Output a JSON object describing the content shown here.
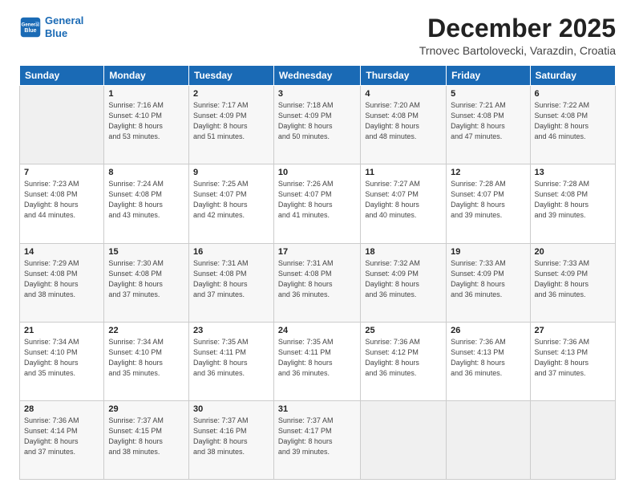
{
  "header": {
    "logo_line1": "General",
    "logo_line2": "Blue",
    "month": "December 2025",
    "location": "Trnovec Bartolovecki, Varazdin, Croatia"
  },
  "weekdays": [
    "Sunday",
    "Monday",
    "Tuesday",
    "Wednesday",
    "Thursday",
    "Friday",
    "Saturday"
  ],
  "weeks": [
    [
      {
        "day": "",
        "text": ""
      },
      {
        "day": "1",
        "text": "Sunrise: 7:16 AM\nSunset: 4:10 PM\nDaylight: 8 hours\nand 53 minutes."
      },
      {
        "day": "2",
        "text": "Sunrise: 7:17 AM\nSunset: 4:09 PM\nDaylight: 8 hours\nand 51 minutes."
      },
      {
        "day": "3",
        "text": "Sunrise: 7:18 AM\nSunset: 4:09 PM\nDaylight: 8 hours\nand 50 minutes."
      },
      {
        "day": "4",
        "text": "Sunrise: 7:20 AM\nSunset: 4:08 PM\nDaylight: 8 hours\nand 48 minutes."
      },
      {
        "day": "5",
        "text": "Sunrise: 7:21 AM\nSunset: 4:08 PM\nDaylight: 8 hours\nand 47 minutes."
      },
      {
        "day": "6",
        "text": "Sunrise: 7:22 AM\nSunset: 4:08 PM\nDaylight: 8 hours\nand 46 minutes."
      }
    ],
    [
      {
        "day": "7",
        "text": "Sunrise: 7:23 AM\nSunset: 4:08 PM\nDaylight: 8 hours\nand 44 minutes."
      },
      {
        "day": "8",
        "text": "Sunrise: 7:24 AM\nSunset: 4:08 PM\nDaylight: 8 hours\nand 43 minutes."
      },
      {
        "day": "9",
        "text": "Sunrise: 7:25 AM\nSunset: 4:07 PM\nDaylight: 8 hours\nand 42 minutes."
      },
      {
        "day": "10",
        "text": "Sunrise: 7:26 AM\nSunset: 4:07 PM\nDaylight: 8 hours\nand 41 minutes."
      },
      {
        "day": "11",
        "text": "Sunrise: 7:27 AM\nSunset: 4:07 PM\nDaylight: 8 hours\nand 40 minutes."
      },
      {
        "day": "12",
        "text": "Sunrise: 7:28 AM\nSunset: 4:07 PM\nDaylight: 8 hours\nand 39 minutes."
      },
      {
        "day": "13",
        "text": "Sunrise: 7:28 AM\nSunset: 4:08 PM\nDaylight: 8 hours\nand 39 minutes."
      }
    ],
    [
      {
        "day": "14",
        "text": "Sunrise: 7:29 AM\nSunset: 4:08 PM\nDaylight: 8 hours\nand 38 minutes."
      },
      {
        "day": "15",
        "text": "Sunrise: 7:30 AM\nSunset: 4:08 PM\nDaylight: 8 hours\nand 37 minutes."
      },
      {
        "day": "16",
        "text": "Sunrise: 7:31 AM\nSunset: 4:08 PM\nDaylight: 8 hours\nand 37 minutes."
      },
      {
        "day": "17",
        "text": "Sunrise: 7:31 AM\nSunset: 4:08 PM\nDaylight: 8 hours\nand 36 minutes."
      },
      {
        "day": "18",
        "text": "Sunrise: 7:32 AM\nSunset: 4:09 PM\nDaylight: 8 hours\nand 36 minutes."
      },
      {
        "day": "19",
        "text": "Sunrise: 7:33 AM\nSunset: 4:09 PM\nDaylight: 8 hours\nand 36 minutes."
      },
      {
        "day": "20",
        "text": "Sunrise: 7:33 AM\nSunset: 4:09 PM\nDaylight: 8 hours\nand 36 minutes."
      }
    ],
    [
      {
        "day": "21",
        "text": "Sunrise: 7:34 AM\nSunset: 4:10 PM\nDaylight: 8 hours\nand 35 minutes."
      },
      {
        "day": "22",
        "text": "Sunrise: 7:34 AM\nSunset: 4:10 PM\nDaylight: 8 hours\nand 35 minutes."
      },
      {
        "day": "23",
        "text": "Sunrise: 7:35 AM\nSunset: 4:11 PM\nDaylight: 8 hours\nand 36 minutes."
      },
      {
        "day": "24",
        "text": "Sunrise: 7:35 AM\nSunset: 4:11 PM\nDaylight: 8 hours\nand 36 minutes."
      },
      {
        "day": "25",
        "text": "Sunrise: 7:36 AM\nSunset: 4:12 PM\nDaylight: 8 hours\nand 36 minutes."
      },
      {
        "day": "26",
        "text": "Sunrise: 7:36 AM\nSunset: 4:13 PM\nDaylight: 8 hours\nand 36 minutes."
      },
      {
        "day": "27",
        "text": "Sunrise: 7:36 AM\nSunset: 4:13 PM\nDaylight: 8 hours\nand 37 minutes."
      }
    ],
    [
      {
        "day": "28",
        "text": "Sunrise: 7:36 AM\nSunset: 4:14 PM\nDaylight: 8 hours\nand 37 minutes."
      },
      {
        "day": "29",
        "text": "Sunrise: 7:37 AM\nSunset: 4:15 PM\nDaylight: 8 hours\nand 38 minutes."
      },
      {
        "day": "30",
        "text": "Sunrise: 7:37 AM\nSunset: 4:16 PM\nDaylight: 8 hours\nand 38 minutes."
      },
      {
        "day": "31",
        "text": "Sunrise: 7:37 AM\nSunset: 4:17 PM\nDaylight: 8 hours\nand 39 minutes."
      },
      {
        "day": "",
        "text": ""
      },
      {
        "day": "",
        "text": ""
      },
      {
        "day": "",
        "text": ""
      }
    ]
  ]
}
